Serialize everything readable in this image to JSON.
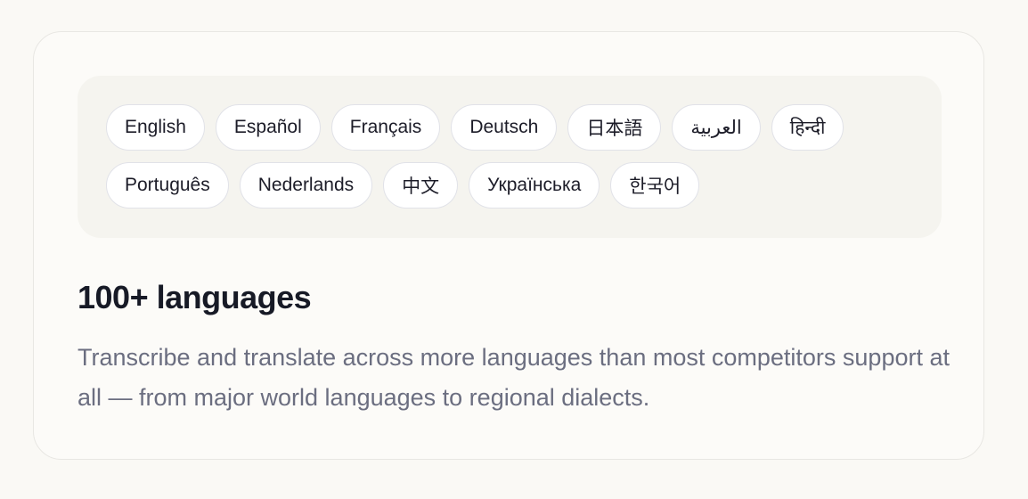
{
  "languages": {
    "row1": [
      "English",
      "Español",
      "Français",
      "Deutsch",
      "日本語",
      "العربية",
      "हिन्दी"
    ],
    "row2": [
      "Português",
      "Nederlands",
      "中文",
      "Українська",
      "한국어"
    ]
  },
  "feature": {
    "title": "100+ languages",
    "description": "Transcribe and translate across more languages than most competitors support at all — from major world languages to regional dialects."
  }
}
